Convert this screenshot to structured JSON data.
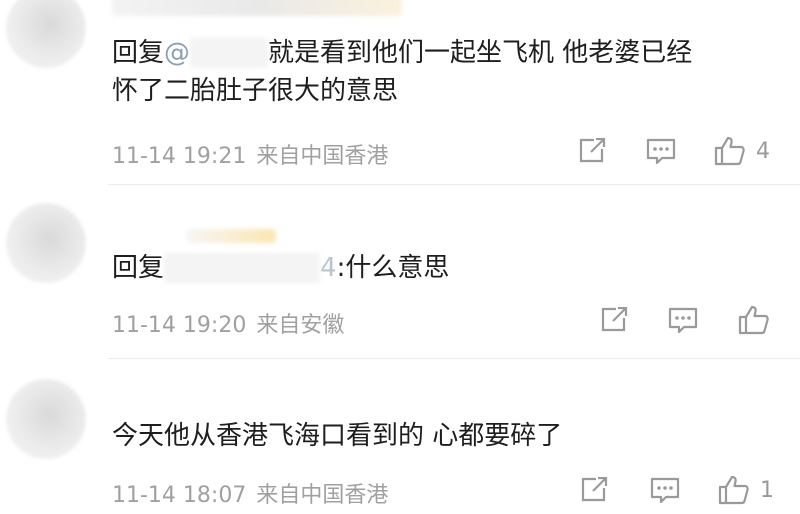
{
  "comments": [
    {
      "reply_prefix": "回复",
      "mention": "@",
      "text_line1": "就是看到他们一起坐飞机 他老婆已经",
      "text_line2": "怀了二胎肚子很大的意思",
      "time": "11-14 19:21",
      "source": "来自中国香港",
      "like_count": "4"
    },
    {
      "reply_prefix": "回复",
      "mention_tail": "4",
      "text": ":什么意思",
      "time": "11-14 19:20",
      "source": "来自安徽",
      "like_count": ""
    },
    {
      "text": "今天他从香港飞海口看到的 心都要碎了",
      "time": "11-14 18:07",
      "source": "来自中国香港",
      "like_count": "1"
    }
  ],
  "icons": [
    "share-icon",
    "comment-icon",
    "like-icon"
  ]
}
